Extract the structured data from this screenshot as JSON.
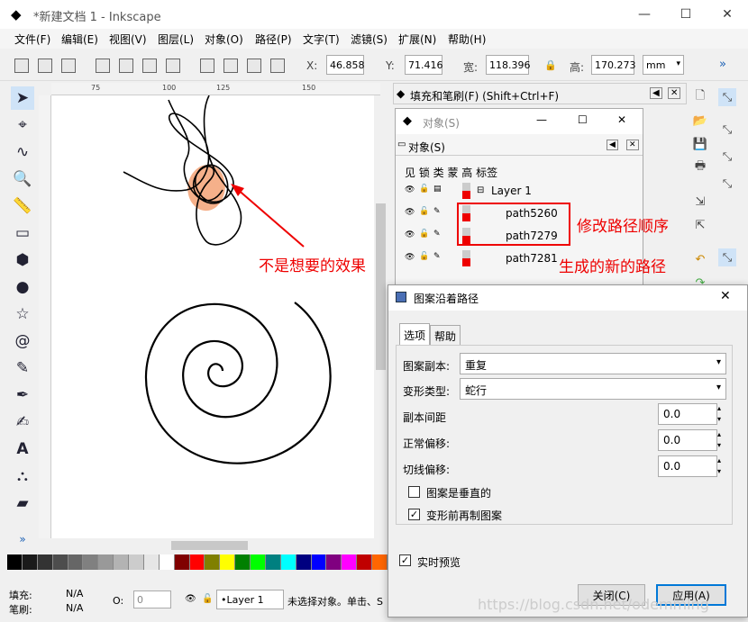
{
  "window": {
    "title": "*新建文档 1 - Inkscape"
  },
  "menu": [
    "文件(F)",
    "编辑(E)",
    "视图(V)",
    "图层(L)",
    "对象(O)",
    "路径(P)",
    "文字(T)",
    "滤镜(S)",
    "扩展(N)",
    "帮助(H)"
  ],
  "toolbar": {
    "x_label": "X:",
    "x_value": "46.858",
    "y_label": "Y:",
    "y_value": "71.416",
    "w_label": "宽:",
    "w_value": "118.396",
    "h_label": "高:",
    "h_value": "170.273",
    "unit": "mm"
  },
  "ruler": {
    "ticks": [
      "75",
      "100",
      "125",
      "150"
    ]
  },
  "fill_panel": {
    "title": "填充和笔刷(F) (Shift+Ctrl+F)"
  },
  "objects": {
    "window_title": "对象(S)",
    "panel_title": "对象(S)",
    "columns": "见 锁 类 蒙 高 标签",
    "layer": "Layer 1",
    "rows": [
      "path5260",
      "path7279",
      "path7281"
    ]
  },
  "annotations": {
    "modify_order": "修改路径顺序",
    "not_wanted": "不是想要的效果",
    "new_path": "生成的新的路径"
  },
  "dialog": {
    "title": "图案沿着路径",
    "tab_options": "选项",
    "tab_help": "帮助",
    "copies_label": "图案副本:",
    "copies_value": "重复",
    "deform_label": "变形类型:",
    "deform_value": "蛇行",
    "spacing_label": "副本间距",
    "spacing_value": "0.0",
    "normal_label": "正常偏移:",
    "normal_value": "0.0",
    "tangent_label": "切线偏移:",
    "tangent_value": "0.0",
    "vertical_label": "图案是垂直的",
    "clone_label": "变形前再制图案",
    "preview_label": "实时预览",
    "close_btn": "关闭(C)",
    "apply_btn": "应用(A)"
  },
  "status": {
    "fill_label": "填充:",
    "fill_value": "N/A",
    "stroke_label": "笔刷:",
    "stroke_value": "N/A",
    "opacity_label": "O:",
    "opacity_value": "0",
    "layer": "•Layer 1",
    "message": "未选择对象。单击、S"
  },
  "watermark": "https://blog.csdn.net/odemming",
  "palette_colors": [
    "#000000",
    "#1a1a1a",
    "#333333",
    "#4d4d4d",
    "#666666",
    "#808080",
    "#999999",
    "#b3b3b3",
    "#cccccc",
    "#e6e6e6",
    "#ffffff",
    "#800000",
    "#ff0000",
    "#808000",
    "#ffff00",
    "#008000",
    "#00ff00",
    "#008080",
    "#00ffff",
    "#000080",
    "#0000ff",
    "#800080",
    "#ff00ff",
    "#c00000",
    "#ff6600"
  ]
}
